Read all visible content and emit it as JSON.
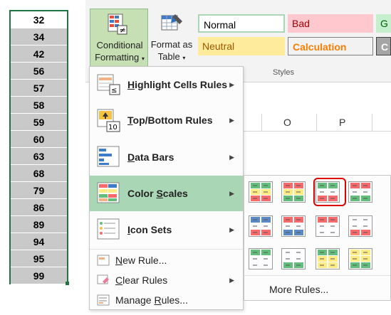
{
  "column_values": [
    "32",
    "34",
    "42",
    "56",
    "57",
    "58",
    "59",
    "60",
    "63",
    "68",
    "79",
    "86",
    "89",
    "94",
    "95",
    "99"
  ],
  "ribbon": {
    "conditional_formatting_line1": "Conditional",
    "conditional_formatting_line2": "Formatting",
    "format_as_table_line1": "Format as",
    "format_as_table_line2": "Table",
    "styles_group_label": "Styles",
    "styles": [
      {
        "label": "Normal"
      },
      {
        "label": "Bad"
      },
      {
        "label": "G"
      },
      {
        "label": "Neutral"
      },
      {
        "label": "Calculation"
      },
      {
        "label": "C"
      }
    ]
  },
  "column_headers": [
    "O",
    "P"
  ],
  "menu": {
    "highlight_cells_rules": "Highlight Cells Rules",
    "top_bottom_rules": "Top/Bottom Rules",
    "data_bars": "Data Bars",
    "color_scales": "Color Scales",
    "icon_sets": "Icon Sets",
    "new_rule": "New Rule...",
    "clear_rules": "Clear Rules",
    "manage_rules": "Manage Rules..."
  },
  "submenu": {
    "more_rules": "More Rules..."
  },
  "colors": {
    "accent_green": "#217346",
    "active_menu": "#a9d6b5",
    "selection_ring": "#dd0000"
  }
}
